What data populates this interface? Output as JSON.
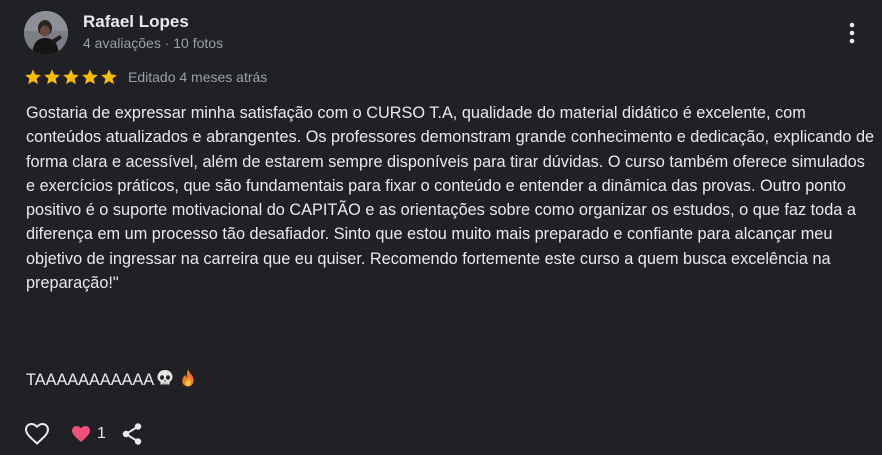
{
  "reviewer": {
    "name": "Rafael Lopes",
    "meta": "4 avaliações · 10 fotos"
  },
  "rating": {
    "stars": 5,
    "max_stars": 5,
    "edited": "Editado 4 meses atrás",
    "star_color": "#fbbc04"
  },
  "review": {
    "text": "Gostaria de expressar minha satisfação com o CURSO T.A, qualidade do material didático é excelente, com conteúdos atualizados e abrangentes. Os professores demonstram grande conhecimento e dedicação, explicando de forma clara e acessível, além de estarem sempre disponíveis para tirar dúvidas. O curso também oferece simulados e exercícios práticos, que são fundamentais para fixar o conteúdo e entender a dinâmica das provas. Outro ponto positivo é o suporte motivacional do CAPITÃO e as orientações sobre como organizar os estudos, o que faz toda a diferença em um processo tão desafiador. Sinto que estou muito mais preparado e confiante para alcançar meu objetivo de ingressar na carreira que eu quiser. Recomendo fortemente este curso a quem busca excelência na preparação!\"",
    "extra_line": "TAAAAAAAAAAA",
    "extra_icons": [
      "skull-emoji-icon",
      "fire-emoji-icon"
    ]
  },
  "actions": {
    "like_icon": "heart-outline-icon",
    "reaction_icon": "heart-filled-icon",
    "reaction_color": "#f0507a",
    "reaction_count": "1",
    "share_icon": "share-icon"
  },
  "menu_icon": "more-vert-icon"
}
